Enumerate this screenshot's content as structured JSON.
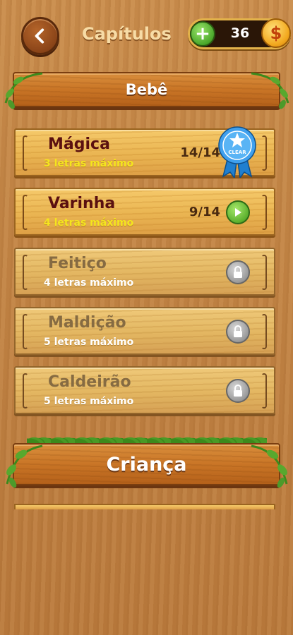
{
  "header": {
    "title": "Capítulos",
    "back_icon": "chevron-left-icon",
    "coins": "36",
    "plus_label": "+",
    "coin_symbol": "$"
  },
  "sections": [
    {
      "label": "Bebê",
      "chapters": [
        {
          "name": "Mágica",
          "subtitle": "3 letras máximo",
          "progress": "14/14",
          "status": "clear",
          "badge": "CLEAR"
        },
        {
          "name": "Varinha",
          "subtitle": "4 letras máximo",
          "progress": "9/14",
          "status": "play"
        },
        {
          "name": "Feitiço",
          "subtitle": "4 letras máximo",
          "progress": "",
          "status": "locked"
        },
        {
          "name": "Maldição",
          "subtitle": "5 letras máximo",
          "progress": "",
          "status": "locked"
        },
        {
          "name": "Caldeirão",
          "subtitle": "5 letras máximo",
          "progress": "",
          "status": "locked"
        }
      ]
    },
    {
      "label": "Criança"
    }
  ],
  "colors": {
    "chapter_name": "#5a1010",
    "subtitle_unlocked": "#f5e51e",
    "subtitle_locked": "#ffffff",
    "banner_text": "#ffffff"
  }
}
